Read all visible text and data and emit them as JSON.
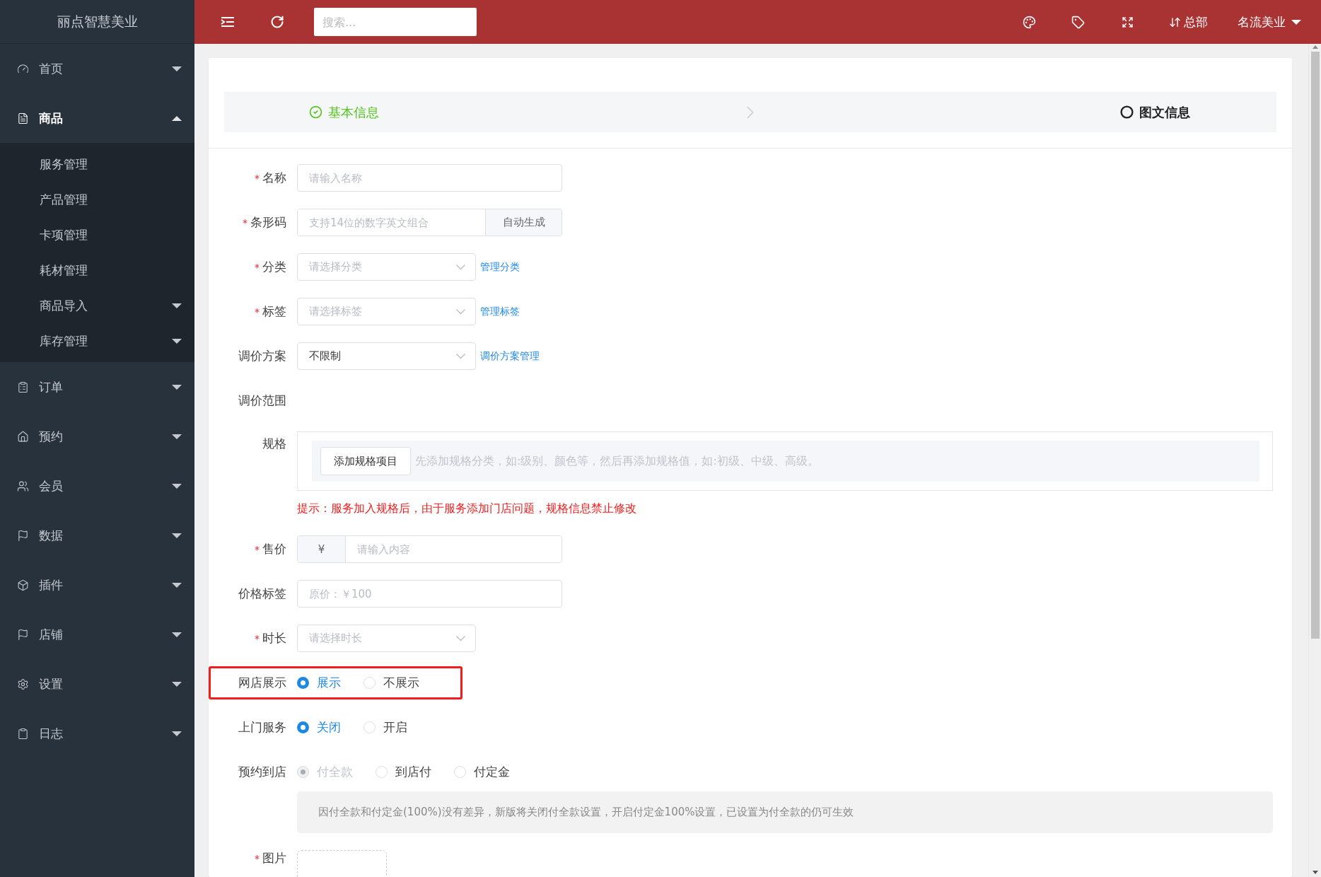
{
  "sidebar": {
    "logo": "丽点智慧美业",
    "items": [
      {
        "label": "首页",
        "expanded": false
      },
      {
        "label": "商品",
        "expanded": true,
        "children": [
          {
            "label": "服务管理",
            "kind": "link"
          },
          {
            "label": "产品管理",
            "kind": "link"
          },
          {
            "label": "卡项管理",
            "kind": "link"
          },
          {
            "label": "耗材管理",
            "kind": "link"
          },
          {
            "label": "商品导入",
            "kind": "group",
            "expanded": false
          },
          {
            "label": "库存管理",
            "kind": "group",
            "expanded": false
          }
        ]
      },
      {
        "label": "订单",
        "expanded": false
      },
      {
        "label": "预约",
        "expanded": false
      },
      {
        "label": "会员",
        "expanded": false
      },
      {
        "label": "数据",
        "expanded": false
      },
      {
        "label": "插件",
        "expanded": false
      },
      {
        "label": "店铺",
        "expanded": false
      },
      {
        "label": "设置",
        "expanded": false
      },
      {
        "label": "日志",
        "expanded": false
      }
    ]
  },
  "topbar": {
    "search": {
      "placeholder": "搜索..."
    },
    "store": "总部",
    "user": "名流美业"
  },
  "steps": [
    {
      "label": "基本信息",
      "done": true
    },
    {
      "label": "图文信息",
      "done": false
    }
  ],
  "form": [
    {
      "kind": "input",
      "label": "名称",
      "mark": "*",
      "placeholder": "请输入名称"
    },
    {
      "kind": "input_button",
      "label": "条形码",
      "mark": "*",
      "placeholder": "支持14位的数字英文组合",
      "button": "自动生成"
    },
    {
      "kind": "select",
      "label": "分类",
      "mark": "*",
      "placeholder": "请选择分类",
      "link": "管理分类"
    },
    {
      "kind": "select",
      "label": "标签",
      "mark": "*",
      "placeholder": "请选择标签",
      "link": "管理标签"
    },
    {
      "kind": "select",
      "label": "调价方案",
      "value": "不限制",
      "link": "调价方案管理"
    },
    {
      "kind": "empty",
      "label": "调价范围"
    },
    {
      "kind": "spec",
      "label": "规格",
      "button": "添加规格项目",
      "hint": "先添加规格分类，如:级别、颜色等，然后再添加规格值，如:初级、中级、高级。",
      "note": "提示：服务加入规格后，由于服务添加门店问题，规格信息禁止修改"
    },
    {
      "kind": "price",
      "label": "售价",
      "mark": "*",
      "prefix": "¥",
      "placeholder": "请输入内容"
    },
    {
      "kind": "input",
      "label": "价格标签",
      "placeholder": "原价：￥100"
    },
    {
      "kind": "select",
      "label": "时长",
      "mark": "*",
      "placeholder": "请选择时长"
    },
    {
      "kind": "radio",
      "label": "网店展示",
      "highlighted": true,
      "options": [
        {
          "label": "展示",
          "selected": true
        },
        {
          "label": "不展示",
          "selected": false
        }
      ]
    },
    {
      "kind": "radio",
      "label": "上门服务",
      "options": [
        {
          "label": "关闭",
          "selected": true
        },
        {
          "label": "开启",
          "selected": false
        }
      ]
    },
    {
      "kind": "radio",
      "label": "预约到店",
      "note": "因付全款和付定金(100%)没有差异，新版将关闭付全款设置，开启付定金100%设置，已设置为付全款的仍可生效",
      "options": [
        {
          "label": "付全款",
          "selected": true,
          "disabled": true
        },
        {
          "label": "到店付",
          "selected": false
        },
        {
          "label": "付定金",
          "selected": false
        }
      ]
    },
    {
      "kind": "upload",
      "label": "图片",
      "mark": "*"
    }
  ]
}
